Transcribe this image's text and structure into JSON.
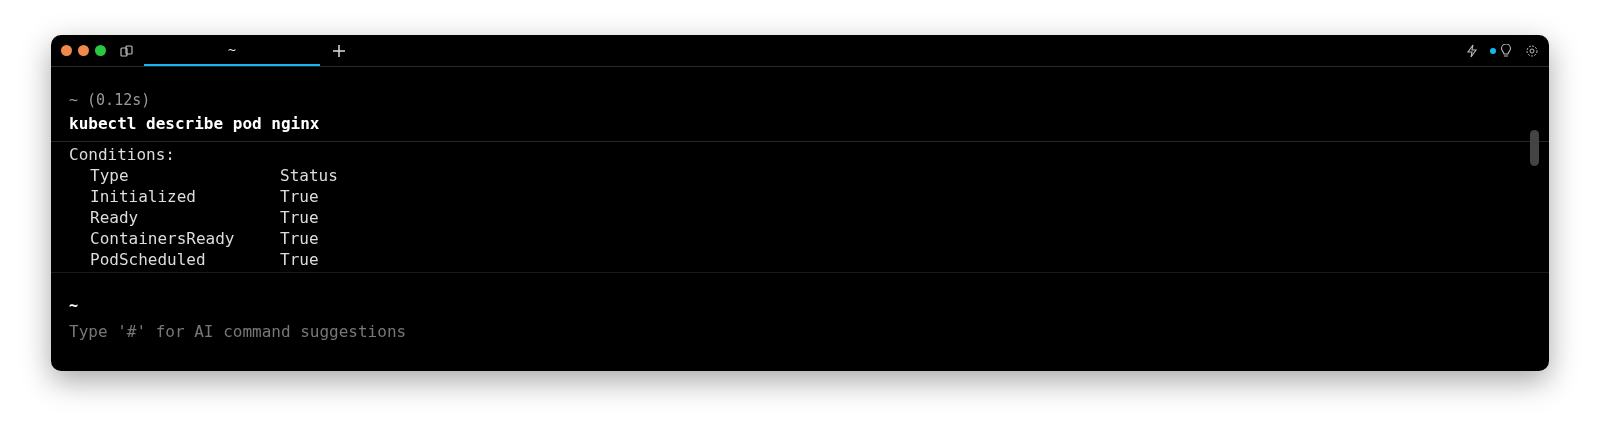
{
  "tabs": [
    {
      "label": "~",
      "selected": true
    }
  ],
  "block": {
    "prompt": "~ (0.12s)",
    "command": "kubectl describe pod nginx",
    "output": {
      "heading": "Conditions:",
      "columns": [
        "Type",
        "Status"
      ],
      "rows": [
        [
          "Initialized",
          "True"
        ],
        [
          "Ready",
          "True"
        ],
        [
          "ContainersReady",
          "True"
        ],
        [
          "PodScheduled",
          "True"
        ]
      ]
    }
  },
  "input": {
    "prompt": "~",
    "placeholder": "Type '#' for AI command suggestions"
  }
}
